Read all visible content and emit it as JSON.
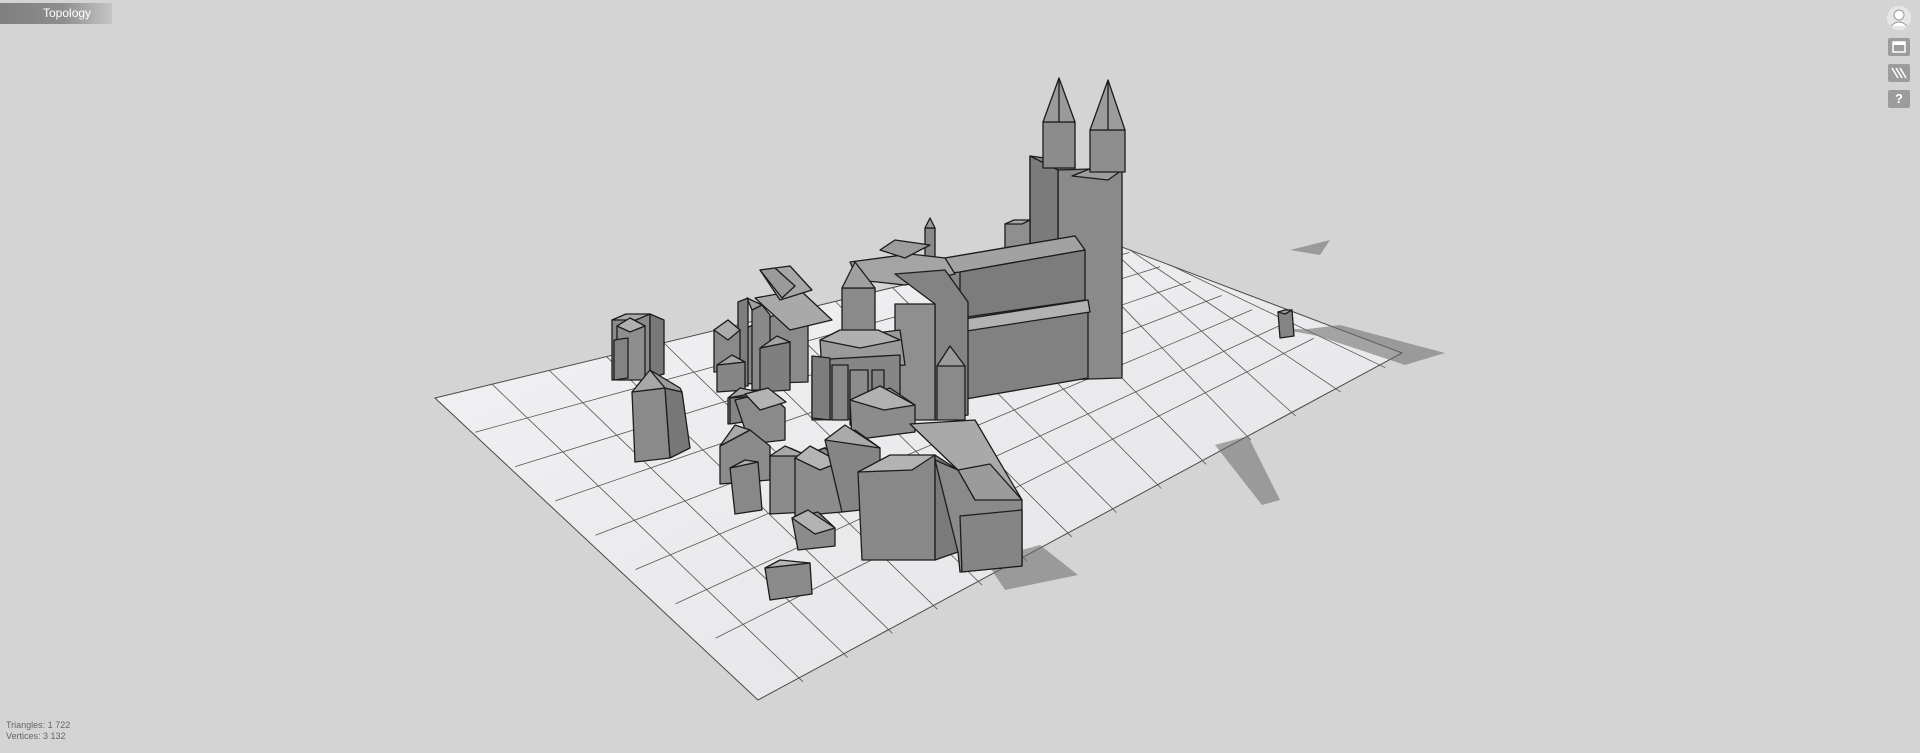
{
  "header": {
    "tab_label": "Topology"
  },
  "toolbar": {
    "buttons": [
      {
        "icon": "avatar-icon"
      },
      {
        "icon": "window-icon"
      },
      {
        "icon": "hatching-icon"
      },
      {
        "icon": "help-icon",
        "label": "?"
      }
    ]
  },
  "stats": {
    "triangles": "Triangles: 1 722",
    "vertices": "Vertices: 3 132"
  }
}
